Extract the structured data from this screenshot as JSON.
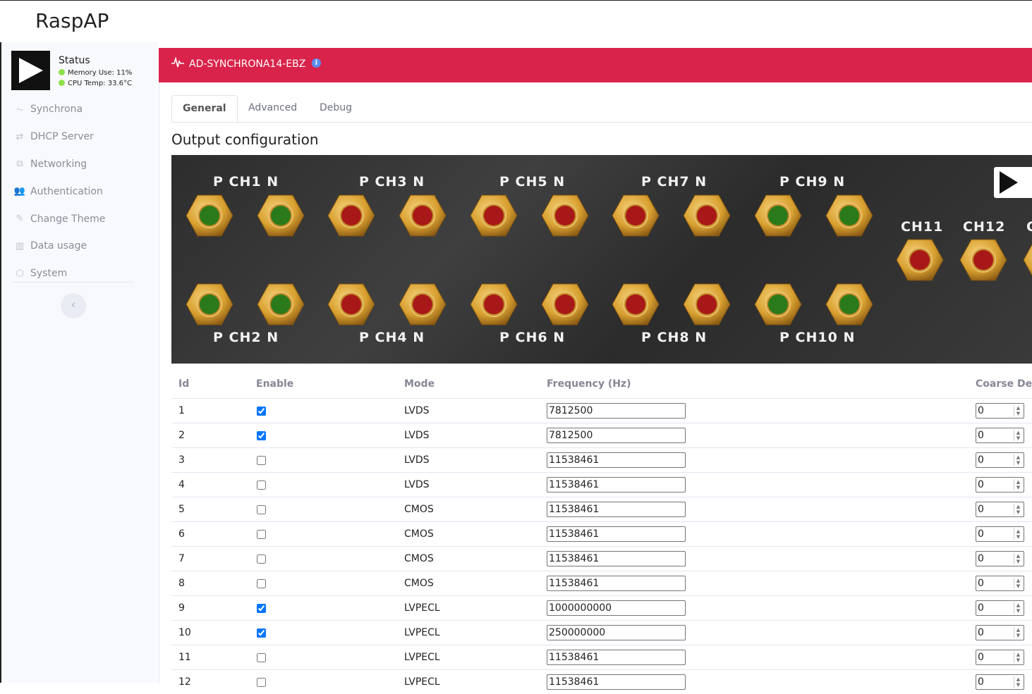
{
  "app": {
    "brand": "RaspAP"
  },
  "status": {
    "title": "Status",
    "memory": "Memory Use: 11%",
    "cpu": "CPU Temp: 33.6°C",
    "indicator_color": "#8ee04a"
  },
  "sidebar": {
    "items": [
      {
        "label": "Synchrona",
        "icon": "pulse-icon"
      },
      {
        "label": "DHCP Server",
        "icon": "exchange-icon"
      },
      {
        "label": "Networking",
        "icon": "network-icon"
      },
      {
        "label": "Authentication",
        "icon": "users-icon"
      },
      {
        "label": "Change Theme",
        "icon": "paint-brush-icon"
      },
      {
        "label": "Data usage",
        "icon": "chart-bar-icon"
      },
      {
        "label": "System",
        "icon": "cube-icon"
      }
    ],
    "collapse_label": "‹"
  },
  "card": {
    "title": "AD-SYNCHRONA14-EBZ",
    "header_color": "#d9234b",
    "info_label": "i"
  },
  "tabs": [
    {
      "label": "General",
      "active": true
    },
    {
      "label": "Advanced",
      "active": false
    },
    {
      "label": "Debug",
      "active": false
    }
  ],
  "section_title": "Output configuration",
  "board": {
    "top_labels": [
      "P CH1 N",
      "P CH3 N",
      "P CH5 N",
      "P CH7 N",
      "P CH9 N"
    ],
    "bottom_labels": [
      "P CH2 N",
      "P CH4 N",
      "P CH6 N",
      "P CH8 N",
      "P CH10 N"
    ],
    "side_labels": [
      "CH11",
      "CH12",
      "C"
    ],
    "top_states": [
      "green",
      "green",
      "red",
      "red",
      "red",
      "red",
      "red",
      "red",
      "green",
      "green"
    ],
    "bottom_states": [
      "green",
      "green",
      "red",
      "red",
      "red",
      "red",
      "red",
      "red",
      "green",
      "green"
    ],
    "side_states": [
      "red",
      "red",
      "red"
    ],
    "colors": {
      "green": "#2a7a1c",
      "red": "#a81818",
      "gold": "#d8a030"
    }
  },
  "table": {
    "headers": [
      "Id",
      "Enable",
      "Mode",
      "Frequency (Hz)",
      "Coarse De"
    ],
    "rows": [
      {
        "id": "1",
        "enabled": true,
        "mode": "LVDS",
        "freq": "7812500",
        "coarse": "0"
      },
      {
        "id": "2",
        "enabled": true,
        "mode": "LVDS",
        "freq": "7812500",
        "coarse": "0"
      },
      {
        "id": "3",
        "enabled": false,
        "mode": "LVDS",
        "freq": "11538461",
        "coarse": "0"
      },
      {
        "id": "4",
        "enabled": false,
        "mode": "LVDS",
        "freq": "11538461",
        "coarse": "0"
      },
      {
        "id": "5",
        "enabled": false,
        "mode": "CMOS",
        "freq": "11538461",
        "coarse": "0"
      },
      {
        "id": "6",
        "enabled": false,
        "mode": "CMOS",
        "freq": "11538461",
        "coarse": "0"
      },
      {
        "id": "7",
        "enabled": false,
        "mode": "CMOS",
        "freq": "11538461",
        "coarse": "0"
      },
      {
        "id": "8",
        "enabled": false,
        "mode": "CMOS",
        "freq": "11538461",
        "coarse": "0"
      },
      {
        "id": "9",
        "enabled": true,
        "mode": "LVPECL",
        "freq": "1000000000",
        "coarse": "0"
      },
      {
        "id": "10",
        "enabled": true,
        "mode": "LVPECL",
        "freq": "250000000",
        "coarse": "0"
      },
      {
        "id": "11",
        "enabled": false,
        "mode": "LVPECL",
        "freq": "11538461",
        "coarse": "0"
      },
      {
        "id": "12",
        "enabled": false,
        "mode": "LVPECL",
        "freq": "11538461",
        "coarse": "0"
      }
    ]
  }
}
